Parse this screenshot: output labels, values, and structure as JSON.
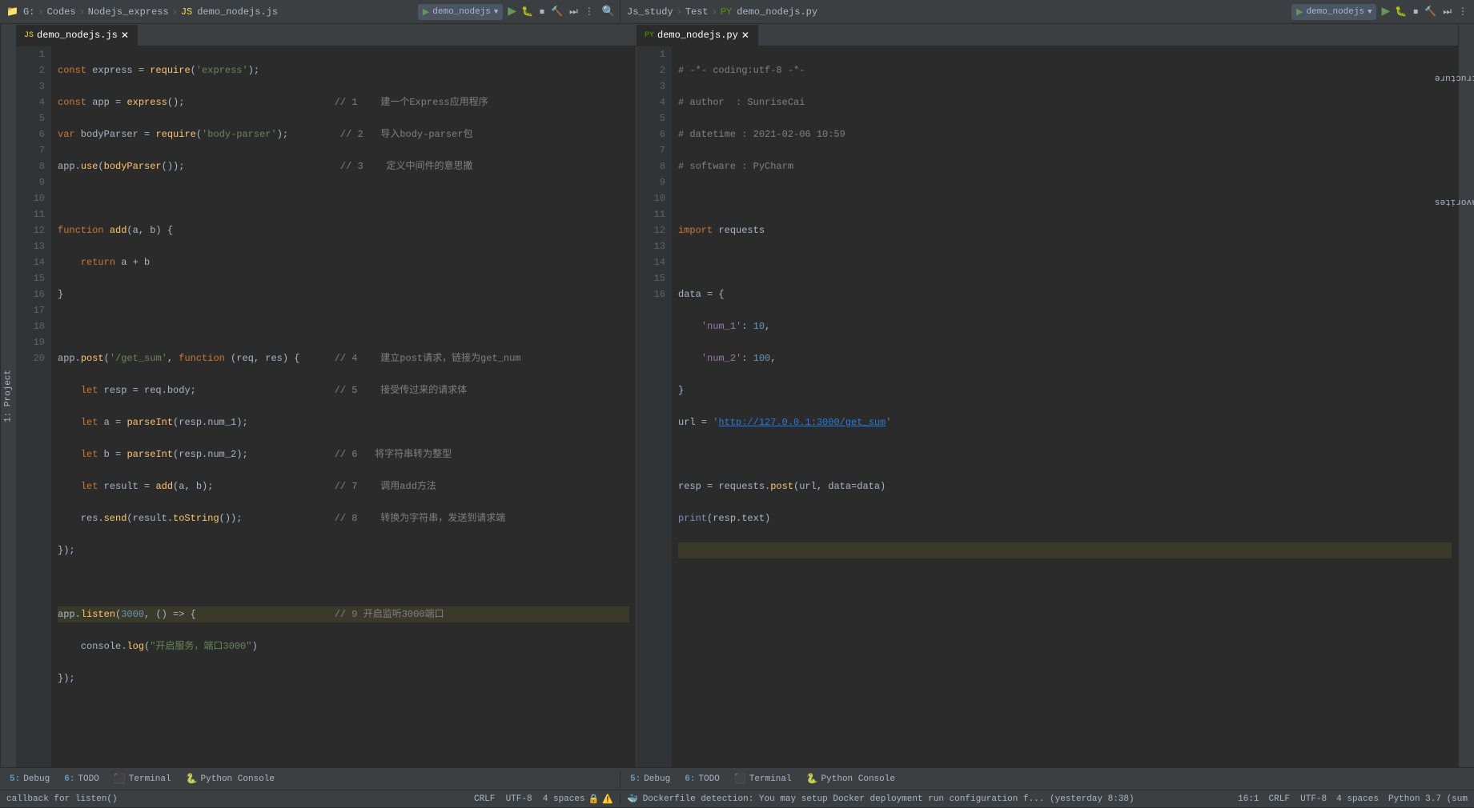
{
  "left_editor": {
    "breadcrumbs": [
      "G:",
      "Codes",
      "Nodejs_express",
      "demo_nodejs.js"
    ],
    "tab_label": "demo_nodejs.js",
    "run_config": "demo_nodejs",
    "lines": [
      {
        "num": 1,
        "content": "const express = require('express');",
        "highlighted": false
      },
      {
        "num": 2,
        "content": "const app = express();                          // 1    建一个Express应用程序",
        "highlighted": false
      },
      {
        "num": 3,
        "content": "var bodyParser = require('body-parser');         // 2   导入body-parser包",
        "highlighted": false
      },
      {
        "num": 4,
        "content": "app.use(bodyParser());                           // 3    定义中间件的意思撒",
        "highlighted": false
      },
      {
        "num": 5,
        "content": "",
        "highlighted": false
      },
      {
        "num": 6,
        "content": "function add(a, b) {",
        "highlighted": false
      },
      {
        "num": 7,
        "content": "    return a + b",
        "highlighted": false
      },
      {
        "num": 8,
        "content": "}",
        "highlighted": false
      },
      {
        "num": 9,
        "content": "",
        "highlighted": false
      },
      {
        "num": 10,
        "content": "app.post('/get_sum', function (req, res) {      // 4    建立post请求，链接为get_num",
        "highlighted": false
      },
      {
        "num": 11,
        "content": "    let resp = req.body;                        // 5    接受传过来的请求体",
        "highlighted": false
      },
      {
        "num": 12,
        "content": "    let a = parseInt(resp.num_1);",
        "highlighted": false
      },
      {
        "num": 13,
        "content": "    let b = parseInt(resp.num_2);               // 6   将字符串转为整型",
        "highlighted": false
      },
      {
        "num": 14,
        "content": "    let result = add(a, b);                     // 7    调用add方法",
        "highlighted": false
      },
      {
        "num": 15,
        "content": "    res.send(result.toString());                // 8    转换为字符串，发送到请求端",
        "highlighted": false
      },
      {
        "num": 16,
        "content": "});",
        "highlighted": false
      },
      {
        "num": 17,
        "content": "",
        "highlighted": false
      },
      {
        "num": 18,
        "content": "app.listen(3000, () => {                        // 9 开启监听3000端口",
        "highlighted": true
      },
      {
        "num": 19,
        "content": "    console.log(\"开启服务，端口3000\")",
        "highlighted": false
      },
      {
        "num": 20,
        "content": "});",
        "highlighted": false
      }
    ],
    "status_text": "callback for listen()",
    "encoding": "CRLF  UTF-8  4 spaces"
  },
  "right_editor": {
    "breadcrumbs": [
      "Js_study",
      "Test",
      "demo_nodejs.py"
    ],
    "tab_label": "demo_nodejs.py",
    "run_config": "demo_nodejs",
    "lines": [
      {
        "num": 1,
        "content": "# -*- coding:utf-8 -*-",
        "highlighted": false
      },
      {
        "num": 2,
        "content": "# author  : SunriseCai",
        "highlighted": false
      },
      {
        "num": 3,
        "content": "# datetime : 2021-02-06 10:59",
        "highlighted": false
      },
      {
        "num": 4,
        "content": "# software : PyCharm",
        "highlighted": false
      },
      {
        "num": 5,
        "content": "",
        "highlighted": false
      },
      {
        "num": 6,
        "content": "import requests",
        "highlighted": false
      },
      {
        "num": 7,
        "content": "",
        "highlighted": false
      },
      {
        "num": 8,
        "content": "data = {",
        "highlighted": false
      },
      {
        "num": 9,
        "content": "    'num_1': 10,",
        "highlighted": false
      },
      {
        "num": 10,
        "content": "    'num_2': 100,",
        "highlighted": false
      },
      {
        "num": 11,
        "content": "}",
        "highlighted": false
      },
      {
        "num": 12,
        "content": "url = 'http://127.0.0.1:3000/get_sum'",
        "highlighted": false
      },
      {
        "num": 13,
        "content": "",
        "highlighted": false
      },
      {
        "num": 14,
        "content": "resp = requests.post(url, data=data)",
        "highlighted": false
      },
      {
        "num": 15,
        "content": "print(resp.text)",
        "highlighted": false
      },
      {
        "num": 16,
        "content": "",
        "highlighted": true
      }
    ],
    "status": {
      "position": "16:1",
      "encoding": "UTF-8",
      "spaces": "4 spaces",
      "python": "Python 3.7 (sum"
    }
  },
  "tools_bar_left": {
    "items": [
      {
        "num": "5:",
        "label": "Debug"
      },
      {
        "num": "6:",
        "label": "TODO"
      },
      {
        "label": "Terminal",
        "icon": ">_"
      },
      {
        "label": "Python Console",
        "icon": "🐍"
      }
    ]
  },
  "tools_bar_right": {
    "items": [
      {
        "num": "5:",
        "label": "Debug"
      },
      {
        "num": "6:",
        "label": "TODO"
      },
      {
        "label": "Terminal"
      },
      {
        "label": "Python Console",
        "icon": "🐍"
      }
    ]
  },
  "notification": "Dockerfile detection: You may setup Docker deployment run configuration f... (yesterday 8:38)",
  "status_bar_right": {
    "position": "16:1",
    "encoding": "CRLF  UTF-8",
    "spaces": "4 spaces",
    "python": "Python 3.7 (sum"
  },
  "status_bar_left": {
    "text": "callback for listen()",
    "encoding": "CRLF  UTF-8  4 spaces"
  }
}
